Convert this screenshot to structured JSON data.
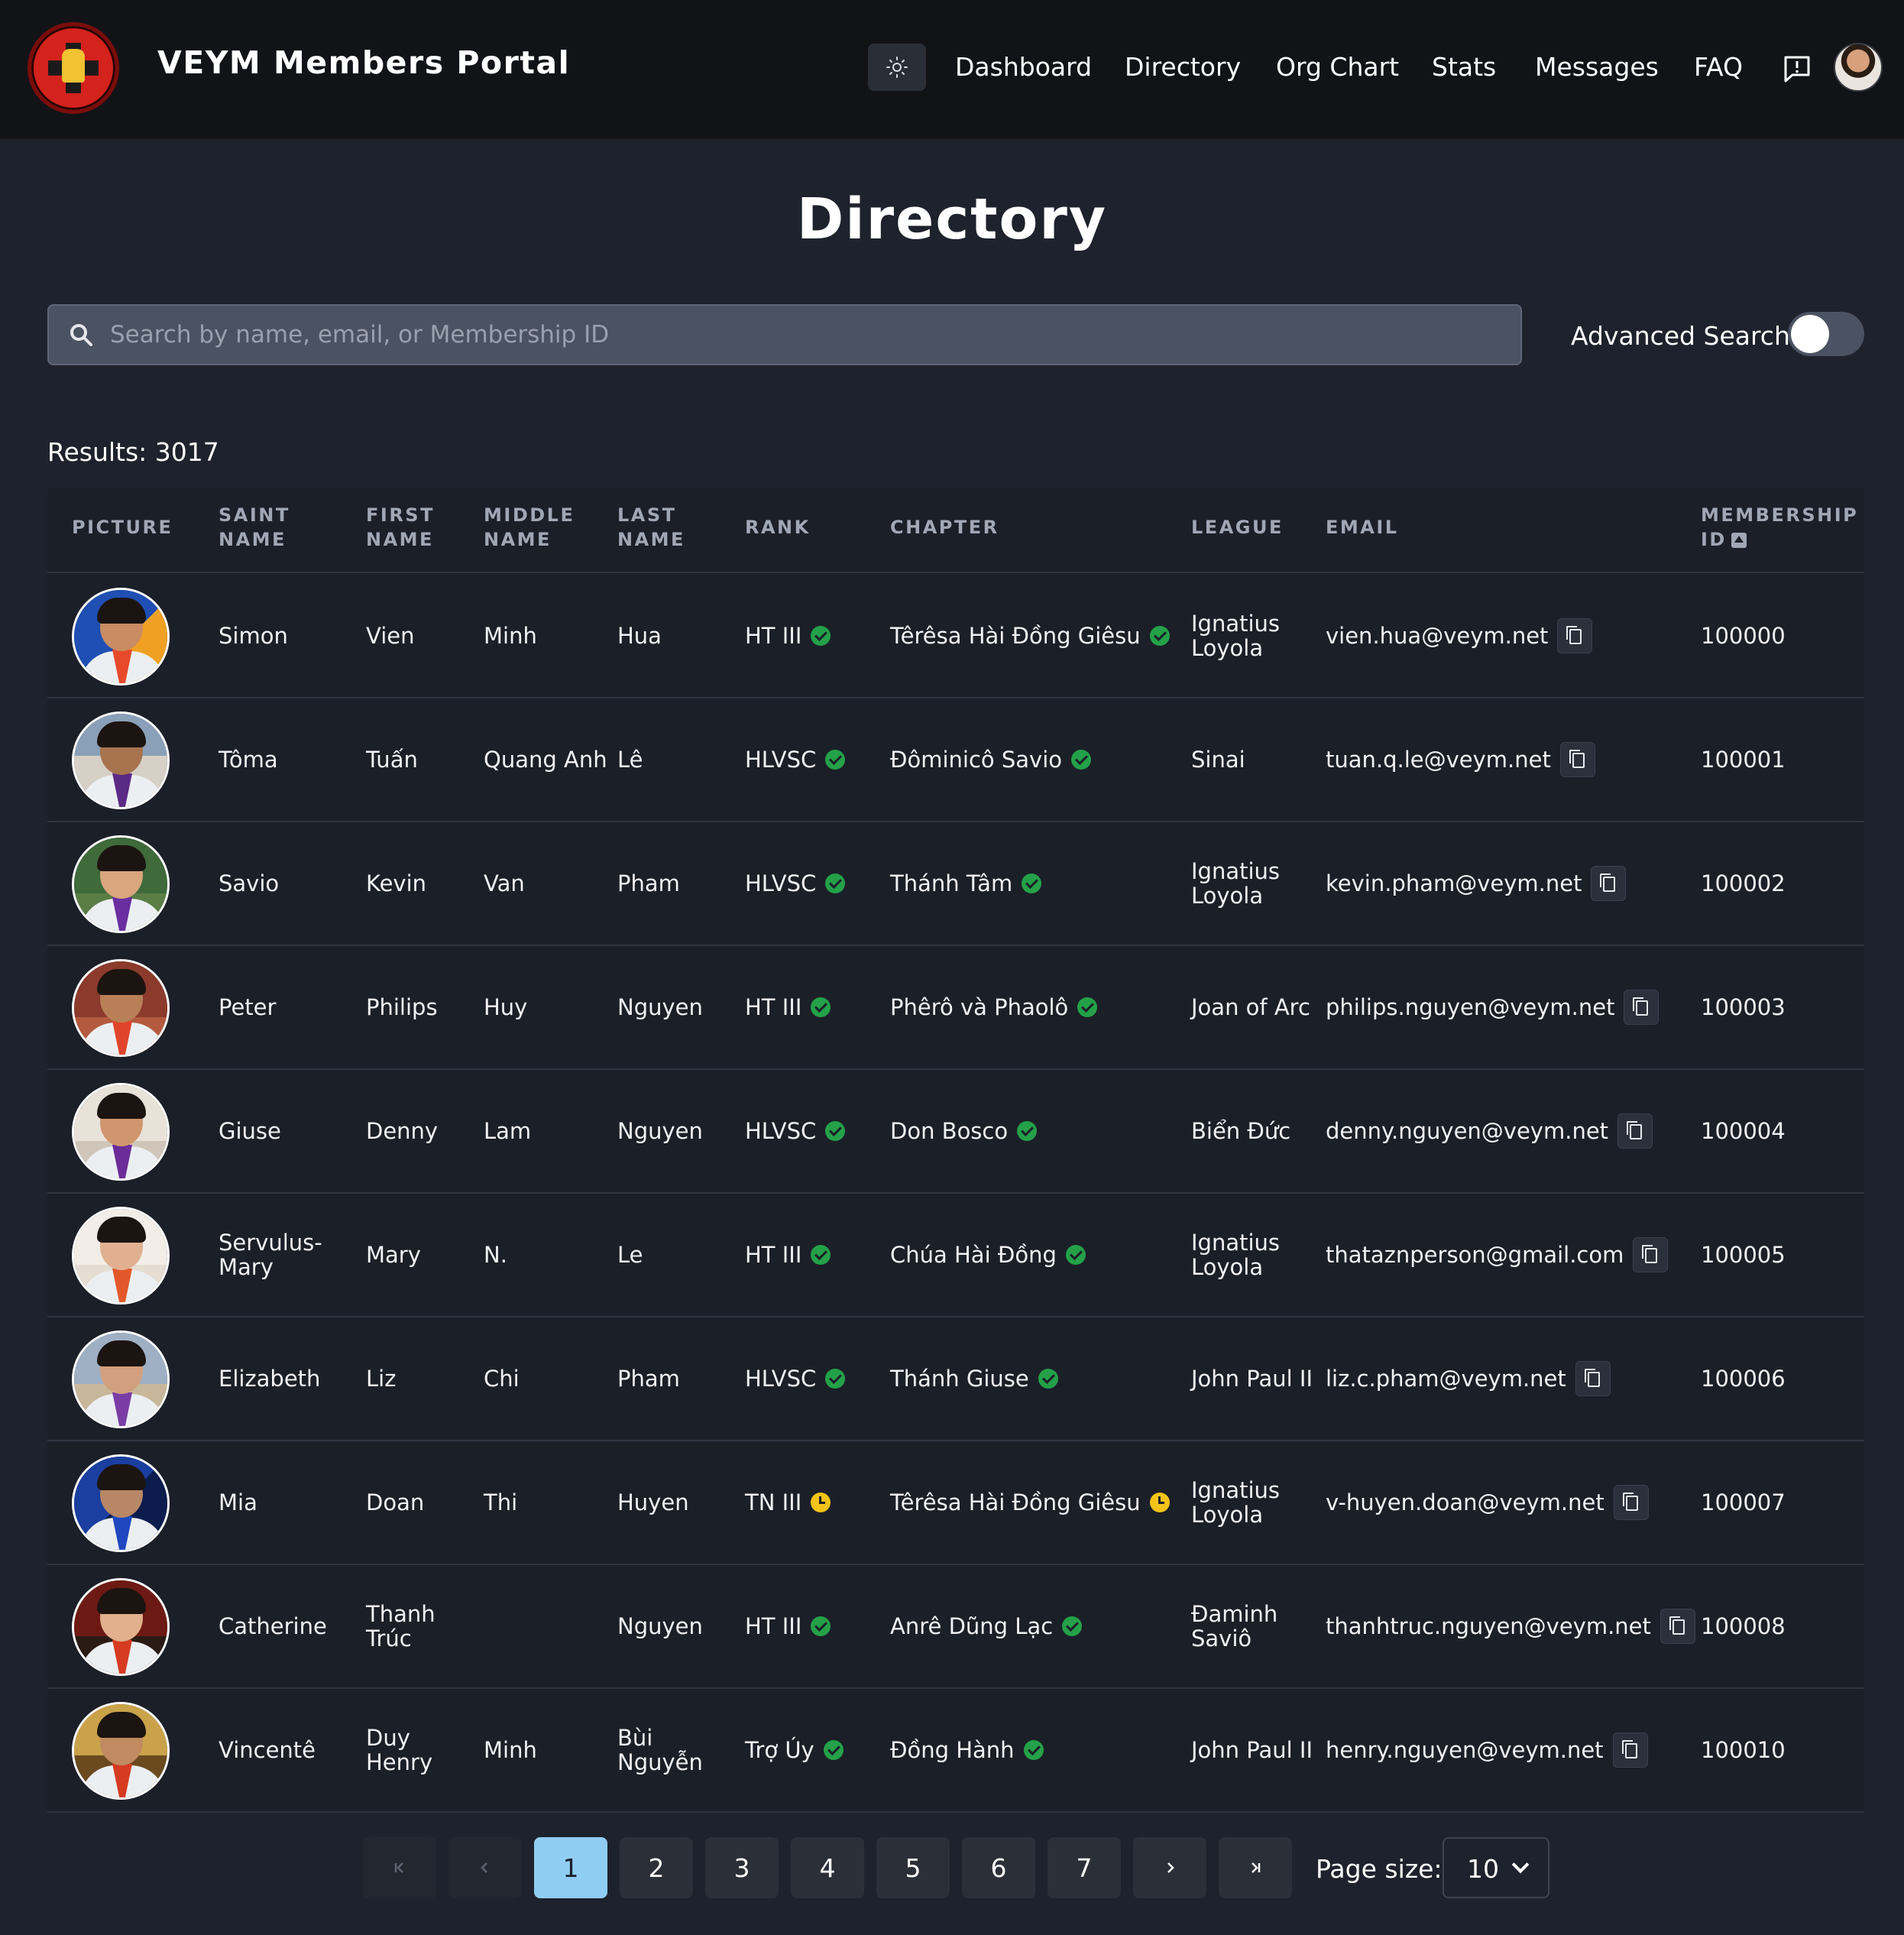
{
  "app": {
    "title": "VEYM Members Portal"
  },
  "nav": {
    "items": [
      {
        "label": "Dashboard"
      },
      {
        "label": "Directory"
      },
      {
        "label": "Org Chart"
      },
      {
        "label": "Stats"
      },
      {
        "label": "Messages"
      },
      {
        "label": "FAQ"
      }
    ],
    "icons": {
      "theme": "sun-icon",
      "feedback": "feedback-icon",
      "avatar": "user-avatar"
    }
  },
  "page": {
    "title": "Directory"
  },
  "search": {
    "placeholder": "Search by name, email, or Membership ID",
    "value": "",
    "advanced_label": "Advanced Search",
    "advanced_enabled": false
  },
  "results": {
    "label": "Results: 3017"
  },
  "table": {
    "headers": {
      "picture": "PICTURE",
      "saint": "SAINT NAME",
      "first": "FIRST NAME",
      "middle": "MIDDLE NAME",
      "last": "LAST NAME",
      "rank": "RANK",
      "chapter": "CHAPTER",
      "league": "LEAGUE",
      "email": "EMAIL",
      "membership": "MEMBERSHIP ID"
    },
    "rows": [
      {
        "saint": "Simon",
        "first": "Vien",
        "middle": "Minh",
        "last": "Hua",
        "rank": "HT III",
        "rank_status": "verified",
        "chapter": "Têrêsa Hài Đồng Giêsu",
        "chapter_status": "verified",
        "league": "Ignatius Loyola",
        "email": "vien.hua@veym.net",
        "id": "100000"
      },
      {
        "saint": "Tôma",
        "first": "Tuấn",
        "middle": "Quang Anh",
        "last": "Lê",
        "rank": "HLVSC",
        "rank_status": "verified",
        "chapter": "Đôminicô Savio",
        "chapter_status": "verified",
        "league": "Sinai",
        "email": "tuan.q.le@veym.net",
        "id": "100001"
      },
      {
        "saint": "Savio",
        "first": "Kevin",
        "middle": "Van",
        "last": "Pham",
        "rank": "HLVSC",
        "rank_status": "verified",
        "chapter": "Thánh Tâm",
        "chapter_status": "verified",
        "league": "Ignatius Loyola",
        "email": "kevin.pham@veym.net",
        "id": "100002"
      },
      {
        "saint": "Peter",
        "first": "Philips",
        "middle": "Huy",
        "last": "Nguyen",
        "rank": "HT III",
        "rank_status": "verified",
        "chapter": "Phêrô và Phaolô",
        "chapter_status": "verified",
        "league": "Joan of Arc",
        "email": "philips.nguyen@veym.net",
        "id": "100003"
      },
      {
        "saint": "Giuse",
        "first": "Denny",
        "middle": "Lam",
        "last": "Nguyen",
        "rank": "HLVSC",
        "rank_status": "verified",
        "chapter": "Don Bosco",
        "chapter_status": "verified",
        "league": "Biển Đức",
        "email": "denny.nguyen@veym.net",
        "id": "100004"
      },
      {
        "saint": "Servulus-Mary",
        "first": "Mary",
        "middle": "N.",
        "last": "Le",
        "rank": "HT III",
        "rank_status": "verified",
        "chapter": "Chúa Hài Đồng",
        "chapter_status": "verified",
        "league": "Ignatius Loyola",
        "email": "thataznperson@gmail.com",
        "id": "100005"
      },
      {
        "saint": "Elizabeth",
        "first": "Liz",
        "middle": "Chi",
        "last": "Pham",
        "rank": "HLVSC",
        "rank_status": "verified",
        "chapter": "Thánh Giuse",
        "chapter_status": "verified",
        "league": "John Paul II",
        "email": "liz.c.pham@veym.net",
        "id": "100006"
      },
      {
        "saint": "Mia",
        "first": "Doan",
        "middle": "Thi",
        "last": "Huyen",
        "rank": "TN III",
        "rank_status": "pending",
        "chapter": "Têrêsa Hài Đồng Giêsu",
        "chapter_status": "pending",
        "league": "Ignatius Loyola",
        "email": "v-huyen.doan@veym.net",
        "id": "100007"
      },
      {
        "saint": "Catherine",
        "first": "Thanh Trúc",
        "middle": "",
        "last": "Nguyen",
        "rank": "HT III",
        "rank_status": "verified",
        "chapter": "Anrê Dũng Lạc",
        "chapter_status": "verified",
        "league": "Đaminh Saviô",
        "email": "thanhtruc.nguyen@veym.net",
        "id": "100008"
      },
      {
        "saint": "Vincentê",
        "first": "Duy Henry",
        "middle": "Minh",
        "last": "Bùi Nguyễn",
        "rank": "Trợ Úy",
        "rank_status": "verified",
        "chapter": "Đồng Hành",
        "chapter_status": "verified",
        "league": "John Paul II",
        "email": "henry.nguyen@veym.net",
        "id": "100010"
      }
    ]
  },
  "pagination": {
    "first_icon": "first-page-icon",
    "prev_icon": "chevron-left-icon",
    "pages": [
      "1",
      "2",
      "3",
      "4",
      "5",
      "6",
      "7"
    ],
    "current": "1",
    "next_icon": "chevron-right-icon",
    "last_icon": "last-page-icon",
    "page_size_label": "Page size:",
    "page_size": "10"
  }
}
